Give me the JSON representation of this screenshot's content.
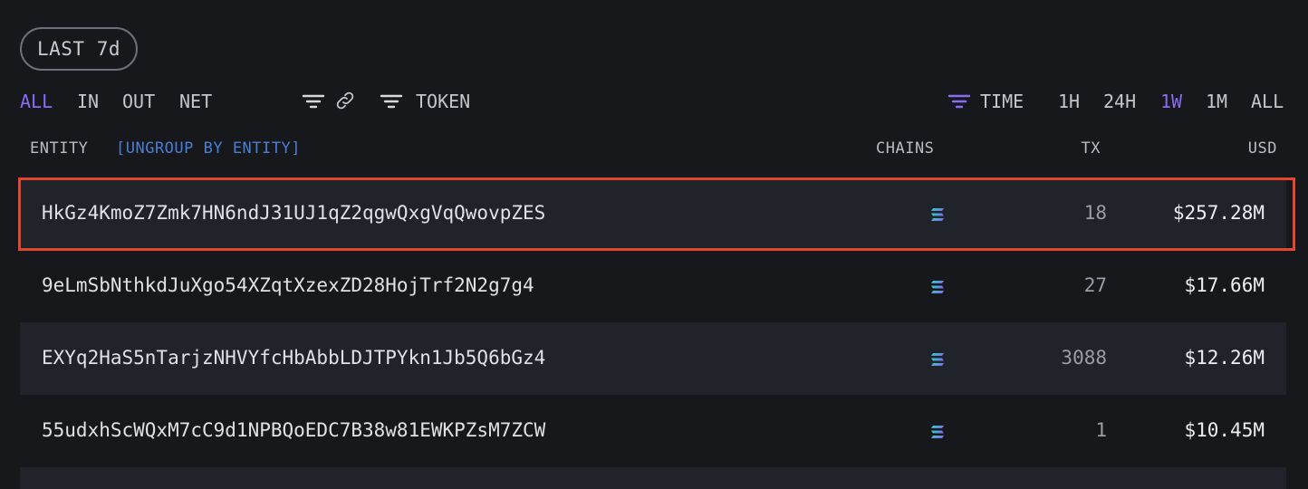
{
  "period_pill": "LAST 7d",
  "flow_filters": [
    {
      "label": "ALL",
      "active": true
    },
    {
      "label": "IN",
      "active": false
    },
    {
      "label": "OUT",
      "active": false
    },
    {
      "label": "NET",
      "active": false
    }
  ],
  "icons": {
    "filter": "filter-lines-icon",
    "link": "link-icon",
    "token_filter": "filter-lines-icon",
    "time_filter": "filter-lines-icon",
    "chain": "solana-icon"
  },
  "token_label": "TOKEN",
  "time_label": "TIME",
  "time_ranges": [
    {
      "label": "1H",
      "active": false
    },
    {
      "label": "24H",
      "active": false
    },
    {
      "label": "1W",
      "active": true
    },
    {
      "label": "1M",
      "active": false
    },
    {
      "label": "ALL",
      "active": false
    }
  ],
  "columns": {
    "entity": "ENTITY",
    "ungroup": "[UNGROUP BY ENTITY]",
    "chains": "CHAINS",
    "tx": "TX",
    "usd": "USD"
  },
  "rows": [
    {
      "address": "HkGz4KmoZ7Zmk7HN6ndJ31UJ1qZ2qgwQxgVqQwovpZES",
      "tx": "18",
      "usd": "$257.28M",
      "highlighted": true
    },
    {
      "address": "9eLmSbNthkdJuXgo54XZqtXzexZD28HojTrf2N2g7g4",
      "tx": "27",
      "usd": "$17.66M",
      "highlighted": false
    },
    {
      "address": "EXYq2HaS5nTarjzNHVYfcHbAbbLDJTPYkn1Jb5Q6bGz4",
      "tx": "3088",
      "usd": "$12.26M",
      "highlighted": false
    },
    {
      "address": "55udxhScWQxM7cC9d1NPBQoEDC7B38w81EWKPZsM7ZCW",
      "tx": "1",
      "usd": "$10.45M",
      "highlighted": false
    }
  ],
  "colors": {
    "background": "#16181c",
    "row_alt": "#20232a",
    "accent": "#8a6cf2",
    "link": "#4a7ed4",
    "highlight_border": "#e0472d"
  }
}
